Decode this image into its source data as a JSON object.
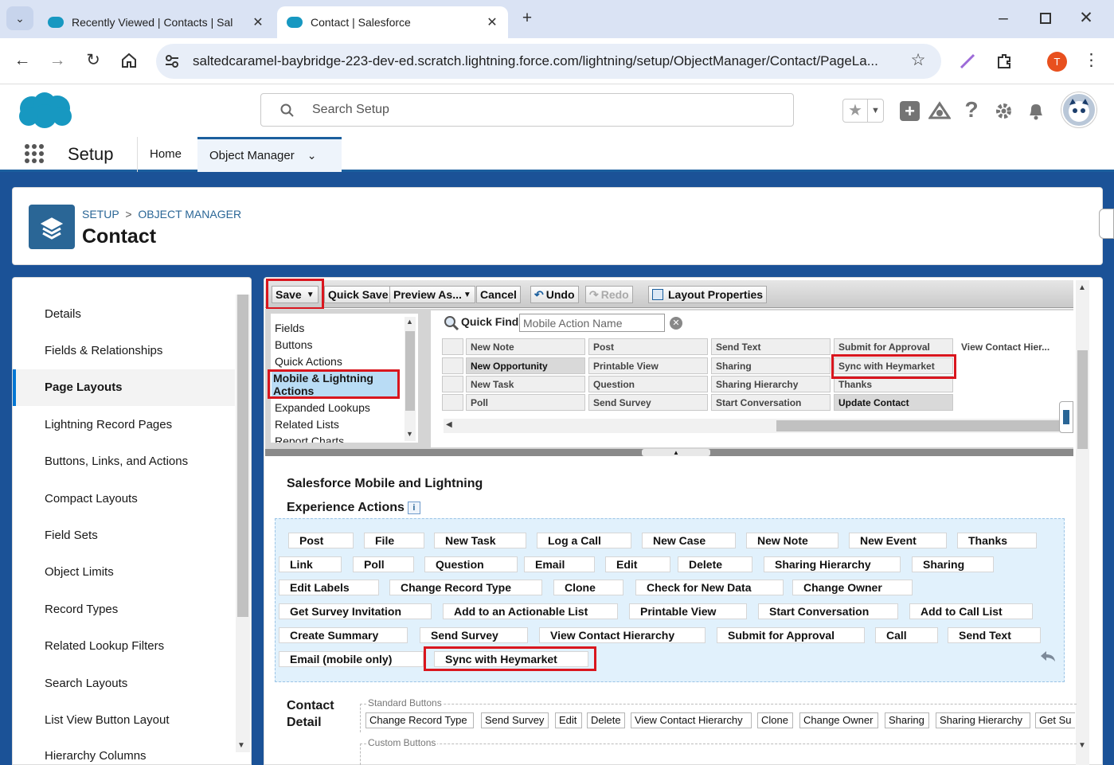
{
  "browser": {
    "tabs": [
      {
        "title": "Recently Viewed | Contacts | Sal",
        "active": false
      },
      {
        "title": "Contact | Salesforce",
        "active": true
      }
    ],
    "url": "saltedcaramel-baybridge-223-dev-ed.scratch.lightning.force.com/lightning/setup/ObjectManager/Contact/PageLa...",
    "profile_initial": "T"
  },
  "header": {
    "search_placeholder": "Search Setup"
  },
  "nav": {
    "app_name": "Setup",
    "home": "Home",
    "object_manager": "Object Manager"
  },
  "page": {
    "breadcrumb_setup": "SETUP",
    "breadcrumb_sep": ">",
    "breadcrumb_om": "OBJECT MANAGER",
    "title": "Contact"
  },
  "sidebar": {
    "items": [
      {
        "label": "Details"
      },
      {
        "label": "Fields & Relationships"
      },
      {
        "label": "Page Layouts",
        "active": true
      },
      {
        "label": "Lightning Record Pages"
      },
      {
        "label": "Buttons, Links, and Actions"
      },
      {
        "label": "Compact Layouts"
      },
      {
        "label": "Field Sets"
      },
      {
        "label": "Object Limits"
      },
      {
        "label": "Record Types"
      },
      {
        "label": "Related Lookup Filters"
      },
      {
        "label": "Search Layouts"
      },
      {
        "label": "List View Button Layout"
      },
      {
        "label": "Hierarchy Columns"
      }
    ]
  },
  "toolbar": {
    "save": "Save",
    "quick_save": "Quick Save",
    "preview_as": "Preview As...",
    "cancel": "Cancel",
    "undo": "Undo",
    "redo": "Redo",
    "layout_properties": "Layout Properties"
  },
  "palette": {
    "categories": [
      "Fields",
      "Buttons",
      "Quick Actions",
      "Mobile & Lightning Actions",
      "Expanded Lookups",
      "Related Lists",
      "Report Charts"
    ],
    "selected_category": "Mobile & Lightning Actions",
    "quick_find_label": "Quick Find",
    "quick_find_placeholder": "Mobile Action Name",
    "columns": [
      [
        "New Note",
        "New Opportunity",
        "New Task",
        "Poll"
      ],
      [
        "Post",
        "Printable View",
        "Question",
        "Send Survey"
      ],
      [
        "Send Text",
        "Sharing",
        "Sharing Hierarchy",
        "Start Conversation"
      ],
      [
        "Submit for Approval",
        "Sync with Heymarket",
        "Thanks",
        "Update Contact"
      ],
      [
        "View Contact Hier..."
      ]
    ]
  },
  "mobile_section": {
    "title_line1": "Salesforce Mobile and Lightning",
    "title_line2": "Experience Actions",
    "info": "i",
    "rows": [
      [
        "Post",
        "File",
        "New Task",
        "Log a Call",
        "New Case",
        "New Note",
        "New Event",
        "Thanks"
      ],
      [
        "Link",
        "Poll",
        "Question",
        "Email",
        "Edit",
        "Delete",
        "Sharing Hierarchy",
        "Sharing"
      ],
      [
        "Edit Labels",
        "Change Record Type",
        "Clone",
        "Check for New Data",
        "Change Owner"
      ],
      [
        "Get Survey Invitation",
        "Add to an Actionable List",
        "Printable View",
        "Start Conversation",
        "Add to Call List"
      ],
      [
        "Create Summary",
        "Send Survey",
        "View Contact Hierarchy",
        "Submit for Approval",
        "Call",
        "Send Text"
      ],
      [
        "Email (mobile only)",
        "Sync with Heymarket"
      ]
    ]
  },
  "contact_detail": {
    "title_line1": "Contact",
    "title_line2": "Detail",
    "standard_buttons_label": "Standard Buttons",
    "standard_buttons": [
      "Change Record Type",
      "Send Survey",
      "Edit",
      "Delete",
      "View Contact Hierarchy",
      "Clone",
      "Change Owner",
      "Sharing",
      "Sharing Hierarchy",
      "Get Su"
    ],
    "custom_buttons_label": "Custom Buttons"
  },
  "colors": {
    "brand_blue": "#1b5297",
    "accent": "#0176d3",
    "highlight_red": "#d9161e",
    "drop_zone": "#e1f1fc"
  }
}
